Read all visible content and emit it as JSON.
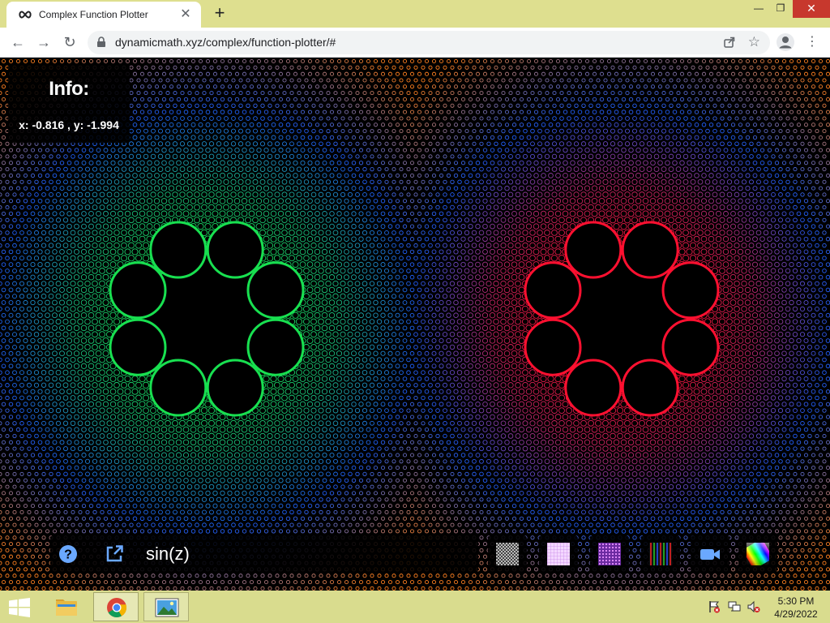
{
  "browser": {
    "tab_title": "Complex Function Plotter",
    "tab_close": "✕",
    "new_tab": "+",
    "window_min": "—",
    "window_max": "❐",
    "window_close": "✕",
    "url": "dynamicmath.xyz/complex/function-plotter/#",
    "back": "←",
    "forward": "→",
    "reload": "↻",
    "star": "☆",
    "menu": "⋮"
  },
  "info": {
    "title": "Info:",
    "coords": "x: -0.816 , y: -1.994"
  },
  "controls": {
    "function_value": "sin(z)",
    "tools": [
      {
        "name": "checker-pattern-icon"
      },
      {
        "name": "grid-pattern-icon"
      },
      {
        "name": "dot-pattern-icon"
      },
      {
        "name": "stripe-pattern-icon"
      },
      {
        "name": "video-camera-icon"
      },
      {
        "name": "color-wheel-icon"
      }
    ]
  },
  "colors": {
    "left_core": "#18e050",
    "right_core": "#ff1030",
    "mid_ring": "#2060ff",
    "outer_ring": "#ff8020",
    "window_close": "#c7382d",
    "chrome_frame": "#dedf8f"
  },
  "taskbar": {
    "time": "5:30 PM",
    "date": "4/29/2022"
  }
}
